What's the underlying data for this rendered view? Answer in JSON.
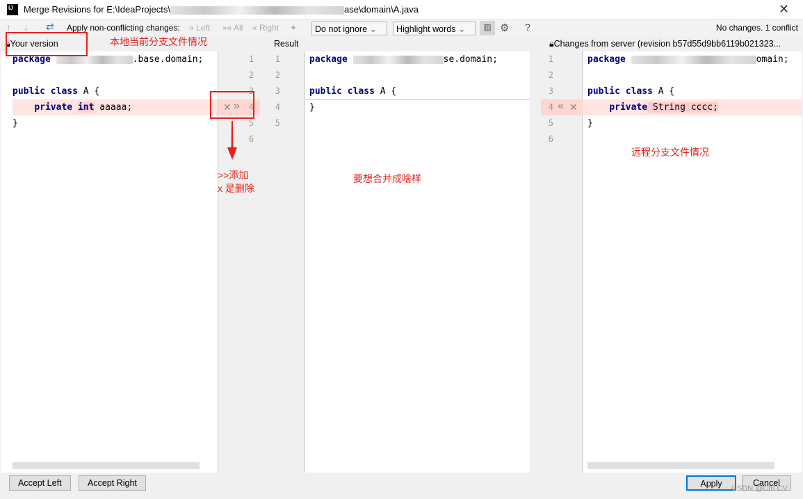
{
  "window": {
    "title_prefix": "Merge Revisions for E:\\IdeaProjects\\",
    "title_suffix": "ase\\domain\\A.java",
    "logo": "IJ",
    "close_icon": "close-icon"
  },
  "toolbar": {
    "prev": "↑",
    "next": "↓",
    "apply_label": "Apply non-conflicting changes:",
    "left": "Left",
    "all": "All",
    "right": "Right",
    "ignore_select": "Do not ignore",
    "highlight_select": "Highlight words",
    "help": "?",
    "status": "No changes. 1 conflict"
  },
  "headers": {
    "left": "Your version",
    "center": "Result",
    "right": "Changes from server (revision b57d55d9bb6119b021323..."
  },
  "left_code": {
    "l1_kw": "package",
    "l1_end": ".base.domain;",
    "l3_kw": "public class",
    "l3_rest": " A {",
    "l4_kw1": "private",
    "l4_kw2": "int",
    "l4_rest": " aaaaa;",
    "l5": "}"
  },
  "center_code": {
    "l1_kw": "package",
    "l1_end": "se.domain;",
    "l3_kw": "public class",
    "l3_rest": " A {",
    "l4": "}"
  },
  "right_code": {
    "l1_kw": "package",
    "l1_end": "omain;",
    "l3_kw": "public class",
    "l3_rest": " A {",
    "l4_kw": "private",
    "l4_rest": " String cccc;",
    "l5": "}"
  },
  "line_numbers": {
    "left": [
      "1",
      "2",
      "3",
      "4",
      "5",
      "6"
    ],
    "center": [
      "1",
      "2",
      "3",
      "4",
      "5"
    ],
    "right": [
      "1",
      "2",
      "3",
      "4",
      "5",
      "6"
    ]
  },
  "gutter_actions": {
    "reject": "✕",
    "accept_left": "»",
    "accept_right": "«"
  },
  "annotations": {
    "local": "本地当前分支文件情况",
    "add": ">>添加",
    "delete": "x 是删除",
    "result": "要想合并成啥样",
    "remote": "远程分支文件情况"
  },
  "buttons": {
    "accept_left": "Accept Left",
    "accept_right": "Accept Right",
    "apply": "Apply",
    "cancel": "Cancel"
  },
  "watermark": "CSDN @Ctrl CV"
}
